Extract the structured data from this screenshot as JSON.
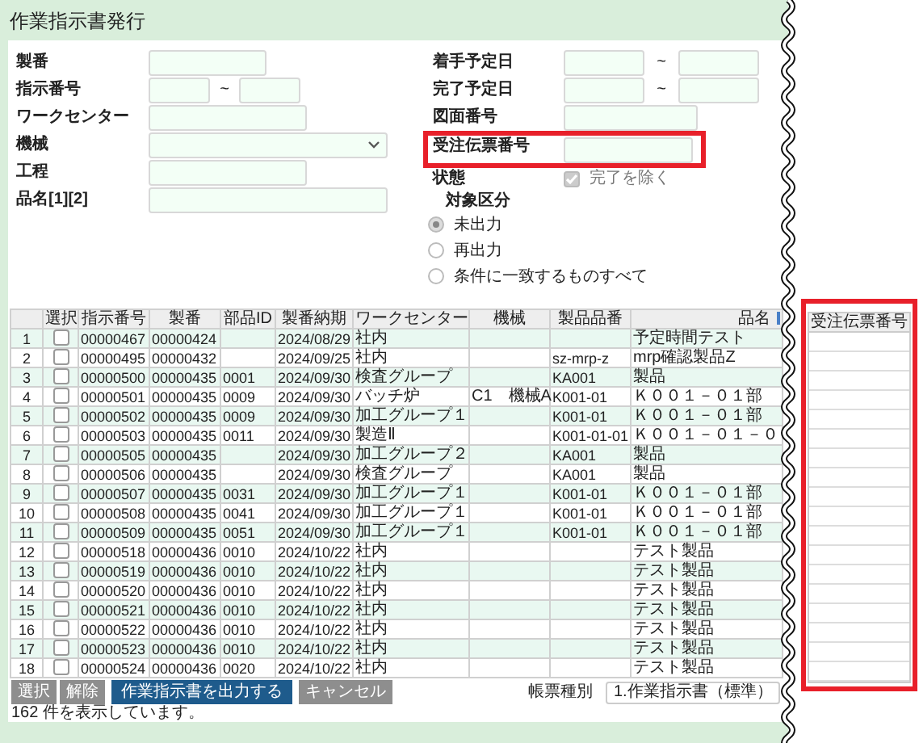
{
  "window": {
    "title": "作業指示書発行"
  },
  "filters_left": [
    {
      "kind": "text",
      "label": "製番"
    },
    {
      "kind": "range",
      "label": "指示番号",
      "separator": "~"
    },
    {
      "kind": "text-wide",
      "label": "ワークセンター"
    },
    {
      "kind": "select",
      "label": "機械"
    },
    {
      "kind": "text-wide",
      "label": "工程"
    },
    {
      "kind": "text-long",
      "label": "品名[1][2]"
    }
  ],
  "filters_right": [
    {
      "kind": "range",
      "label": "着手予定日",
      "separator": "~",
      "highlighted": false
    },
    {
      "kind": "range",
      "label": "完了予定日",
      "separator": "~",
      "highlighted": false
    },
    {
      "kind": "text",
      "label": "図面番号",
      "highlighted": false
    },
    {
      "kind": "text",
      "label": "受注伝票番号",
      "highlighted": true
    }
  ],
  "status_filter": {
    "label": "状態",
    "option": "完了を除く",
    "checked": true,
    "disabled": true
  },
  "target": {
    "label": "対象区分",
    "options": [
      {
        "label": "未出力",
        "selected": true
      },
      {
        "label": "再出力",
        "selected": false
      },
      {
        "label": "条件に一致するものすべて",
        "selected": false
      }
    ]
  },
  "table": {
    "columns": [
      "選択",
      "指示番号",
      "製番",
      "部品ID",
      "製番納期",
      "ワークセンター",
      "機械",
      "製品品番",
      "品名"
    ],
    "rows": [
      {
        "no": "1",
        "checked": false,
        "order_no": "00000467",
        "lot_no": "00000424",
        "due": "2024/08/29",
        "work_center": "社内",
        "product_name": "予定時間テスト"
      },
      {
        "no": "2",
        "checked": false,
        "order_no": "00000495",
        "lot_no": "00000432",
        "due": "2024/09/25",
        "work_center": "社内",
        "product_code": "sz-mrp-z",
        "product_name": "mrp確認製品Z"
      },
      {
        "no": "3",
        "checked": false,
        "order_no": "00000500",
        "lot_no": "00000435",
        "part_id": "0001",
        "due": "2024/09/30",
        "work_center": "検査グループ",
        "product_code": "KA001",
        "product_name": "製品"
      },
      {
        "no": "4",
        "checked": false,
        "order_no": "00000501",
        "lot_no": "00000435",
        "part_id": "0009",
        "due": "2024/09/30",
        "work_center": "バッチ炉",
        "machine": "C1　機械A",
        "product_code": "K001-01",
        "product_name": "Ｋ００１－０１部"
      },
      {
        "no": "5",
        "checked": false,
        "order_no": "00000502",
        "lot_no": "00000435",
        "part_id": "0009",
        "due": "2024/09/30",
        "work_center": "加工グループ１",
        "product_code": "K001-01",
        "product_name": "Ｋ００１－０１部"
      },
      {
        "no": "6",
        "checked": false,
        "order_no": "00000503",
        "lot_no": "00000435",
        "part_id": "0011",
        "due": "2024/09/30",
        "work_center": "製造Ⅱ",
        "product_code": "K001-01-01",
        "product_name": "Ｋ００１－０１－０"
      },
      {
        "no": "7",
        "checked": false,
        "order_no": "00000505",
        "lot_no": "00000435",
        "due": "2024/09/30",
        "work_center": "加工グループ２",
        "product_code": "KA001",
        "product_name": "製品"
      },
      {
        "no": "8",
        "checked": false,
        "order_no": "00000506",
        "lot_no": "00000435",
        "due": "2024/09/30",
        "work_center": "検査グループ",
        "product_code": "KA001",
        "product_name": "製品"
      },
      {
        "no": "9",
        "checked": false,
        "order_no": "00000507",
        "lot_no": "00000435",
        "part_id": "0031",
        "due": "2024/09/30",
        "work_center": "加工グループ１",
        "product_code": "K001-01",
        "product_name": "Ｋ００１－０１部"
      },
      {
        "no": "10",
        "checked": false,
        "order_no": "00000508",
        "lot_no": "00000435",
        "part_id": "0041",
        "due": "2024/09/30",
        "work_center": "加工グループ１",
        "product_code": "K001-01",
        "product_name": "Ｋ００１－０１部"
      },
      {
        "no": "11",
        "checked": false,
        "order_no": "00000509",
        "lot_no": "00000435",
        "part_id": "0051",
        "due": "2024/09/30",
        "work_center": "加工グループ１",
        "product_code": "K001-01",
        "product_name": "Ｋ００１－０１部"
      },
      {
        "no": "12",
        "checked": false,
        "order_no": "00000518",
        "lot_no": "00000436",
        "part_id": "0010",
        "due": "2024/10/22",
        "work_center": "社内",
        "product_name": "テスト製品"
      },
      {
        "no": "13",
        "checked": false,
        "order_no": "00000519",
        "lot_no": "00000436",
        "part_id": "0010",
        "due": "2024/10/22",
        "work_center": "社内",
        "product_name": "テスト製品"
      },
      {
        "no": "14",
        "checked": false,
        "order_no": "00000520",
        "lot_no": "00000436",
        "part_id": "0010",
        "due": "2024/10/22",
        "work_center": "社内",
        "product_name": "テスト製品"
      },
      {
        "no": "15",
        "checked": false,
        "order_no": "00000521",
        "lot_no": "00000436",
        "part_id": "0010",
        "due": "2024/10/22",
        "work_center": "社内",
        "product_name": "テスト製品"
      },
      {
        "no": "16",
        "checked": false,
        "order_no": "00000522",
        "lot_no": "00000436",
        "part_id": "0010",
        "due": "2024/10/22",
        "work_center": "社内",
        "product_name": "テスト製品"
      },
      {
        "no": "17",
        "checked": false,
        "order_no": "00000523",
        "lot_no": "00000436",
        "part_id": "0010",
        "due": "2024/10/22",
        "work_center": "社内",
        "product_name": "テスト製品"
      },
      {
        "no": "18",
        "checked": false,
        "order_no": "00000524",
        "lot_no": "00000436",
        "part_id": "0020",
        "due": "2024/10/22",
        "work_center": "社内",
        "product_name": "テスト製品"
      }
    ]
  },
  "buttons": [
    {
      "label": "選択",
      "kind": "secondary"
    },
    {
      "label": "解除",
      "kind": "secondary"
    },
    {
      "label": "作業指示書を出力する",
      "kind": "primary"
    },
    {
      "label": "キャンセル",
      "kind": "secondary"
    }
  ],
  "result_count": "162 件を表示しています。",
  "report_type": {
    "label": "帳票種別",
    "value": "1.作業指示書（標準）"
  },
  "detached_column": {
    "header": "受注伝票番号",
    "highlighted": true
  }
}
